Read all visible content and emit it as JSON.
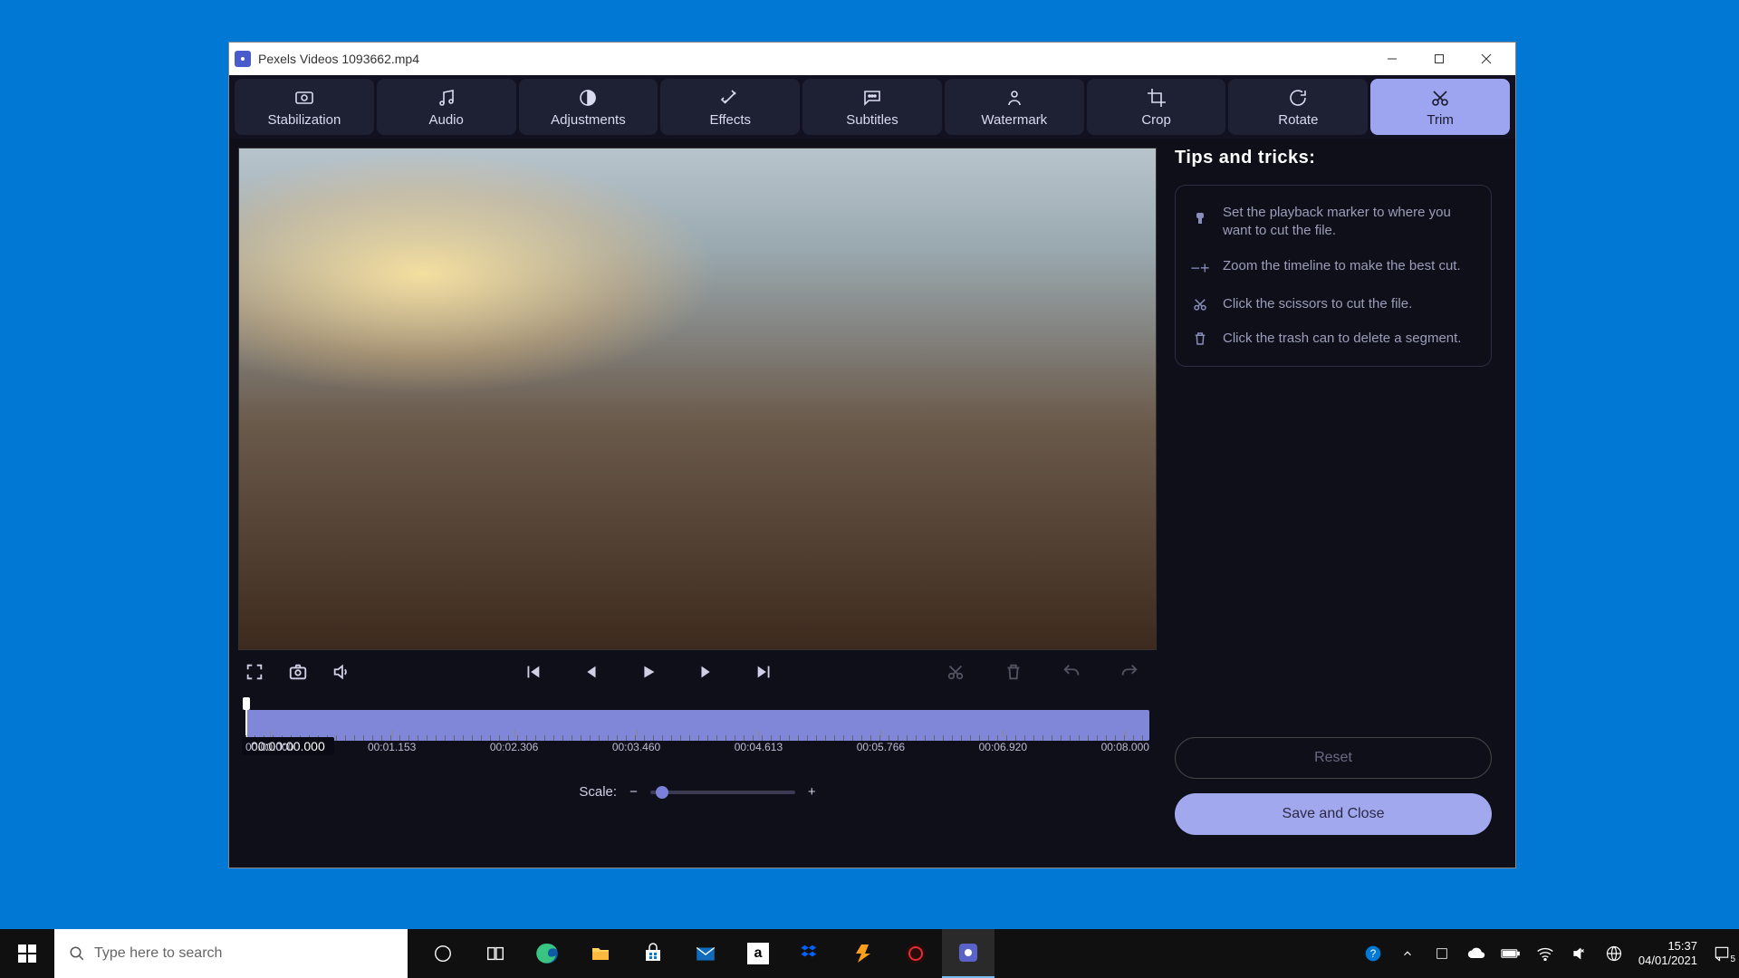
{
  "window": {
    "title": "Pexels Videos 1093662.mp4"
  },
  "toolbar": {
    "items": [
      {
        "label": "Stabilization"
      },
      {
        "label": "Audio"
      },
      {
        "label": "Adjustments"
      },
      {
        "label": "Effects"
      },
      {
        "label": "Subtitles"
      },
      {
        "label": "Watermark"
      },
      {
        "label": "Crop"
      },
      {
        "label": "Rotate"
      },
      {
        "label": "Trim"
      }
    ],
    "active": "Trim"
  },
  "timeline": {
    "cursor_time": "00:00:00.000",
    "ticks": [
      "00:00.000",
      "00:01.153",
      "00:02.306",
      "00:03.460",
      "00:04.613",
      "00:05.766",
      "00:06.920",
      "00:08.000"
    ],
    "scale_label": "Scale:"
  },
  "tips": {
    "title": "Tips and tricks:",
    "items": [
      "Set the playback marker to where you want to cut the file.",
      "Zoom the timeline to make the best cut.",
      "Click the scissors to cut the file.",
      "Click the trash can to delete a segment."
    ]
  },
  "buttons": {
    "reset": "Reset",
    "save": "Save and Close"
  },
  "taskbar": {
    "search_placeholder": "Type here to search",
    "time": "15:37",
    "date": "04/01/2021",
    "notif_count": "5"
  }
}
